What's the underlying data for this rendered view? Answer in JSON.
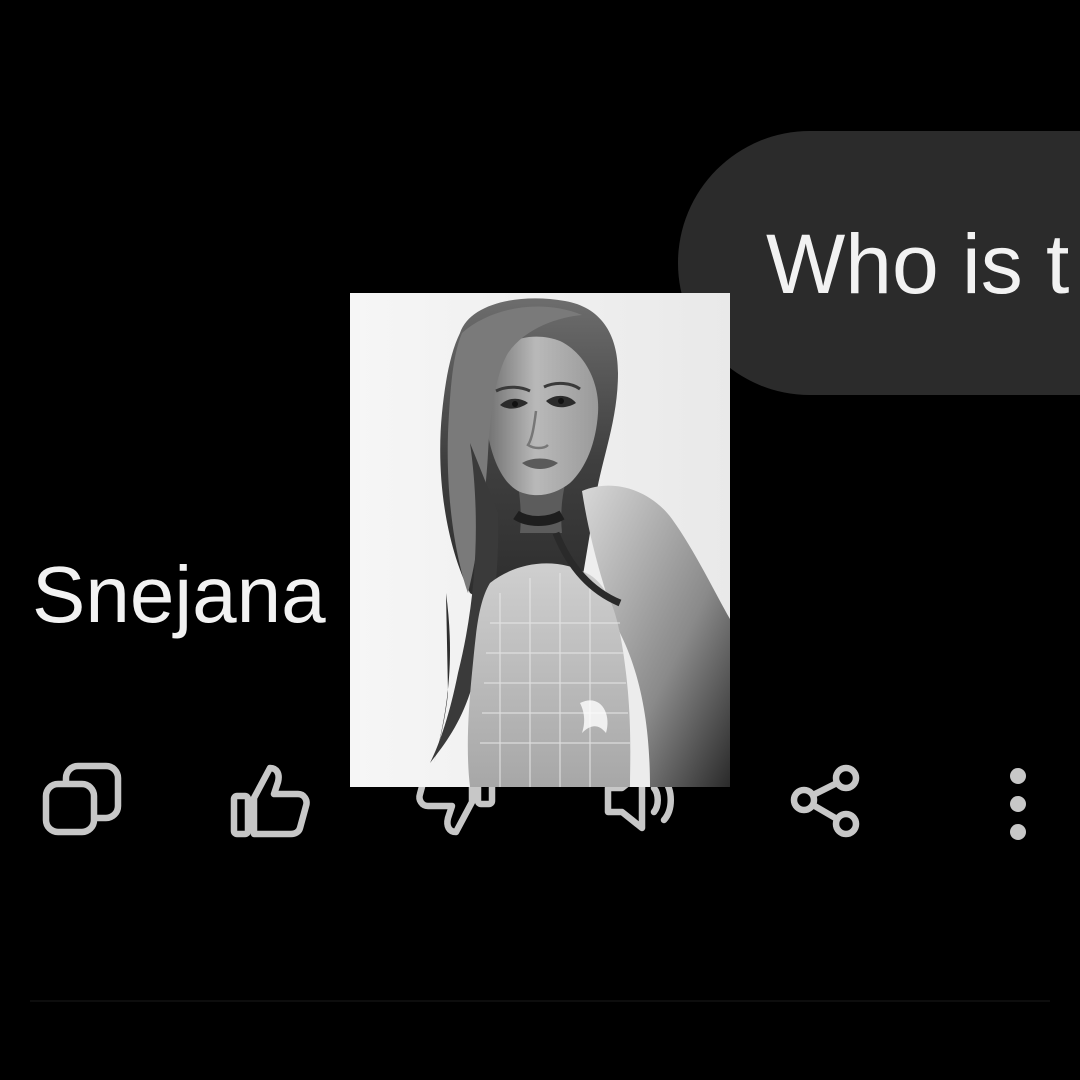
{
  "conversation": {
    "user_prompt": "Who is t",
    "response": "Snejana"
  },
  "toolbar": {
    "actions": [
      {
        "name": "copy",
        "icon": "copy-icon"
      },
      {
        "name": "thumbs-up",
        "icon": "thumbs-up-icon"
      },
      {
        "name": "thumbs-down",
        "icon": "thumbs-down-icon"
      },
      {
        "name": "read-aloud",
        "icon": "speaker-icon"
      },
      {
        "name": "share",
        "icon": "share-icon"
      },
      {
        "name": "more",
        "icon": "more-vertical-icon"
      }
    ]
  },
  "theme": {
    "background": "#000000",
    "bubble": "#2b2b2b",
    "text": "#f2f2f2",
    "icon": "#c7c7c7"
  }
}
